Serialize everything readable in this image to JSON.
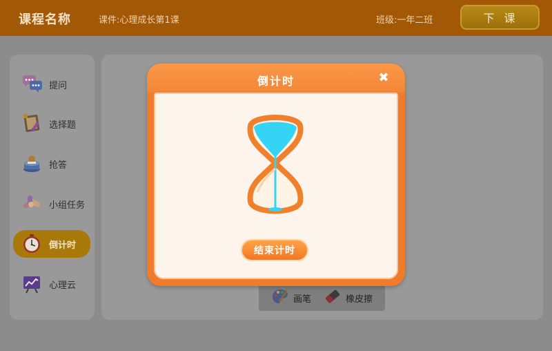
{
  "header": {
    "course_title": "课程名称",
    "courseware": "课件:心理成长第1课",
    "class_info": "班级:一年二班",
    "end_class_label": "下课"
  },
  "sidebar": {
    "items": [
      {
        "label": "提问",
        "icon": "chat-bubbles-icon"
      },
      {
        "label": "选择题",
        "icon": "quiz-board-icon"
      },
      {
        "label": "抢答",
        "icon": "buzzer-icon"
      },
      {
        "label": "小组任务",
        "icon": "group-task-icon"
      },
      {
        "label": "倒计时",
        "icon": "stopwatch-icon",
        "active": true
      },
      {
        "label": "心理云",
        "icon": "chart-board-icon"
      }
    ]
  },
  "toolbar": {
    "pen_label": "画笔",
    "eraser_label": "橡皮擦"
  },
  "timer_dialog": {
    "title": "倒计时",
    "stop_label": "结束计时",
    "close_symbol": "✖"
  },
  "colors": {
    "header_bg": "#a35806",
    "dialog_orange": "#f07c2b",
    "sand": "#35d4f4",
    "active_item": "#a87808"
  }
}
